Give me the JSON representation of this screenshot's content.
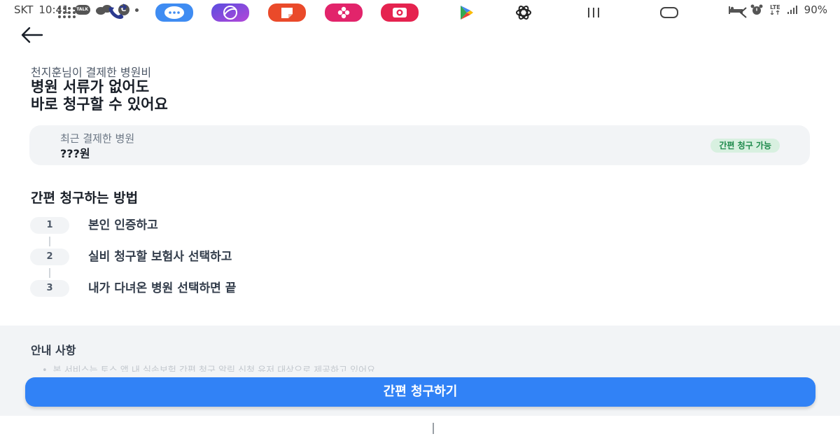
{
  "status_bar": {
    "carrier": "SKT",
    "time": "10:41",
    "talk_label": "TALK",
    "c_label": "C",
    "lte_label": "LTE",
    "battery": "90%"
  },
  "header": {
    "back_icon": "arrow-left-icon"
  },
  "hero": {
    "subtitle": "천지훈님이 결제한 병원비",
    "title_line1": "병원 서류가 없어도",
    "title_line2": "바로 청구할 수 있어요"
  },
  "recent_card": {
    "label": "최근 결제한 병원",
    "amount": "???원",
    "badge": "간편 청구 가능",
    "badge_color": "#1f8a4c"
  },
  "howto": {
    "title": "간편 청구하는 방법",
    "steps": [
      {
        "num": "1",
        "text": "본인 인증하고"
      },
      {
        "num": "2",
        "text": "실비 청구할 보험사 선택하고"
      },
      {
        "num": "3",
        "text": "내가 다녀온 병원 선택하면 끝"
      }
    ]
  },
  "notice": {
    "title": "안내 사항",
    "faded_text": "본 서비스는 토스 앱 내 실손보험 간편 청구 알림 신청 유저 대상으로 제공하고 있어요"
  },
  "cta": {
    "label": "간편 청구하기",
    "color": "#3182f6"
  },
  "nav_dock": {
    "apps": [
      "app-grid-icon",
      "phone-icon",
      "messages-icon",
      "browser-icon",
      "notes-icon",
      "gallery-icon",
      "camera-icon",
      "play-store-icon",
      "chatgpt-icon"
    ],
    "nav_buttons": [
      "recents-icon",
      "home-icon",
      "back-icon"
    ]
  }
}
